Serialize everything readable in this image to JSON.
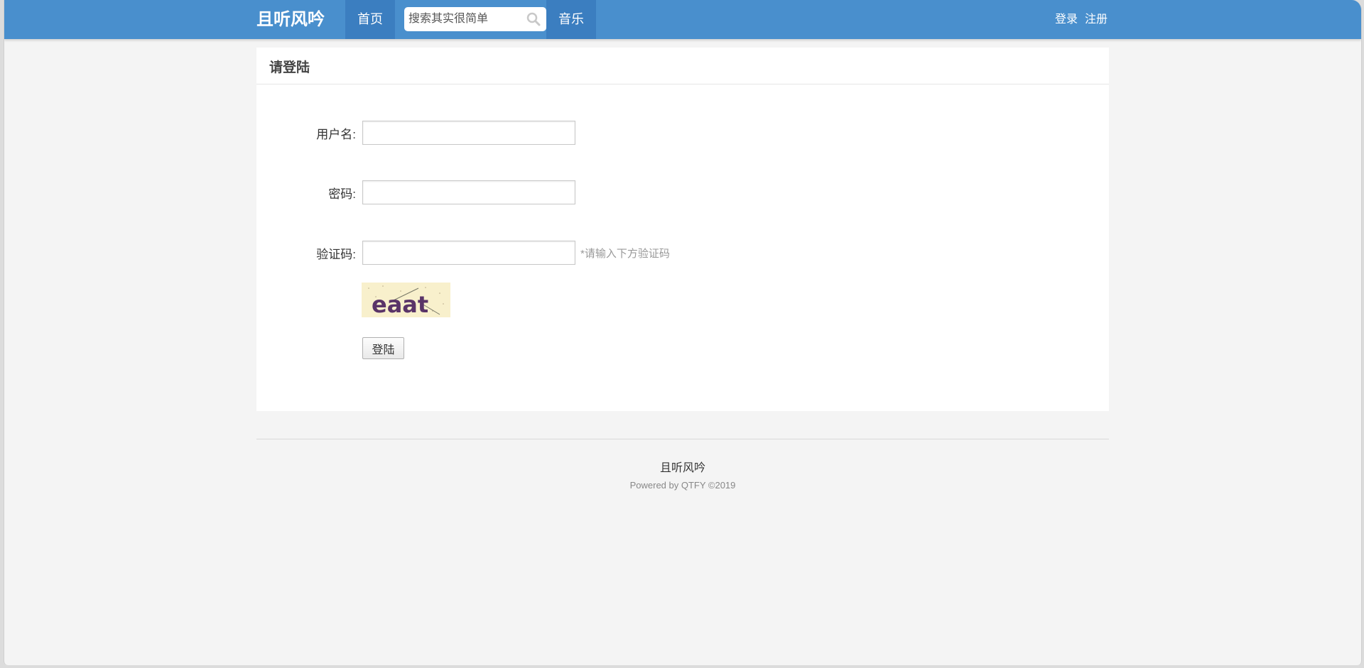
{
  "nav": {
    "logo": "且听风吟",
    "home": "首页",
    "search_placeholder": "搜索其实很简单",
    "music": "音乐",
    "login": "登录",
    "register": "注册"
  },
  "panel": {
    "title": "请登陆",
    "username_label": "用户名:",
    "password_label": "密码:",
    "captcha_label": "验证码:",
    "captcha_hint": "*请输入下方验证码",
    "captcha_text": "eaat",
    "submit": "登陆"
  },
  "footer": {
    "site": "且听风吟",
    "powered": "Powered by QTFY ©2019"
  },
  "colors": {
    "navbar": "#498fcd",
    "nav_active": "#3b7ec0"
  }
}
